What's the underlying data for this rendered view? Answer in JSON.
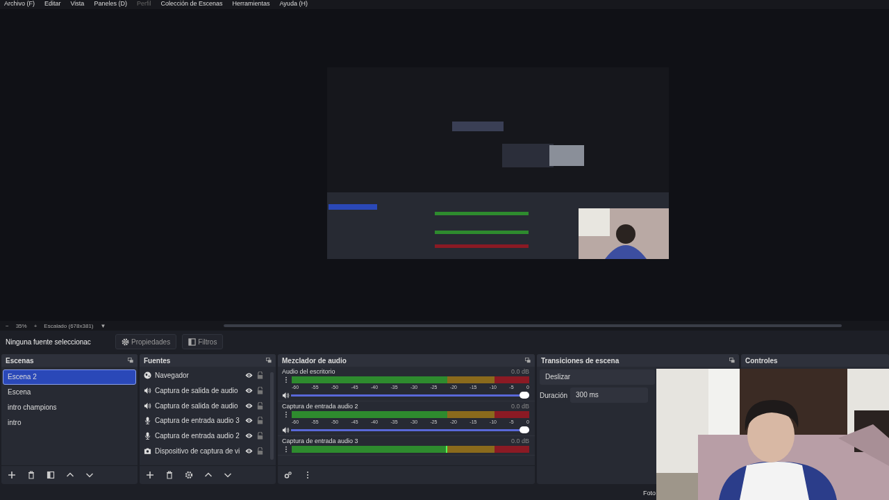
{
  "menu": [
    {
      "label": "Archivo (F)",
      "disabled": false
    },
    {
      "label": "Editar",
      "disabled": false
    },
    {
      "label": "Vista",
      "disabled": false
    },
    {
      "label": "Paneles (D)",
      "disabled": false
    },
    {
      "label": "Perfil",
      "disabled": true
    },
    {
      "label": "Colección de Escenas",
      "disabled": false
    },
    {
      "label": "Herramientas",
      "disabled": false
    },
    {
      "label": "Ayuda (H)",
      "disabled": false
    }
  ],
  "preview": {
    "kind": "picture",
    "zoom_out": "−",
    "zoom": "35%",
    "zoom_in": "+",
    "scaling": "Escalado (678x381)",
    "dropdown": "▼"
  },
  "context_bar": {
    "source": "Ninguna fuente seleccionac",
    "buttons": [
      {
        "label": "Propiedades",
        "kind": "gear"
      },
      {
        "label": "Filtros",
        "kind": "filter"
      }
    ]
  },
  "scenes": {
    "title": "Escenas",
    "items": [
      {
        "label": "Escena 2",
        "selected": true
      },
      {
        "label": "Escena",
        "selected": false
      },
      {
        "label": "intro champions",
        "selected": false
      },
      {
        "label": "intro",
        "selected": false
      }
    ]
  },
  "sources": {
    "title": "Fuentes",
    "items": [
      {
        "label": "Navegador",
        "kind": "browser"
      },
      {
        "label": "Captura de salida de audio",
        "kind": "speaker"
      },
      {
        "label": "Captura de salida de audio",
        "kind": "speaker"
      },
      {
        "label": "Captura de entrada audio 3",
        "kind": "mic"
      },
      {
        "label": "Captura de entrada audio 2",
        "kind": "mic"
      },
      {
        "label": "Dispositivo de captura de vi",
        "kind": "camera"
      }
    ]
  },
  "mixer": {
    "title": "Mezclador de audio",
    "channels": [
      {
        "name": "Audio del escritorio",
        "reading": "0.0 dB",
        "scale": [
          "-60",
          "-55",
          "-50",
          "-45",
          "-40",
          "-35",
          "-30",
          "-25",
          "-20",
          "-15",
          "-10",
          "-5",
          "0"
        ],
        "level": 1
      },
      {
        "name": "Captura de entrada audio 2",
        "reading": "0.0 dB",
        "scale": [
          "-60",
          "-55",
          "-50",
          "-45",
          "-40",
          "-35",
          "-30",
          "-25",
          "-20",
          "-15",
          "-10",
          "-5",
          "0"
        ],
        "level": 1
      },
      {
        "name": "Captura de entrada audio 3",
        "reading": "0.0 dB"
      }
    ]
  },
  "transitions": {
    "title": "Transiciones de escena",
    "transition": "Deslizar",
    "duration_label": "Duración",
    "duration": "300 ms"
  },
  "controls": {
    "title": "Controles"
  },
  "status_bar": {
    "text": "Foto"
  }
}
